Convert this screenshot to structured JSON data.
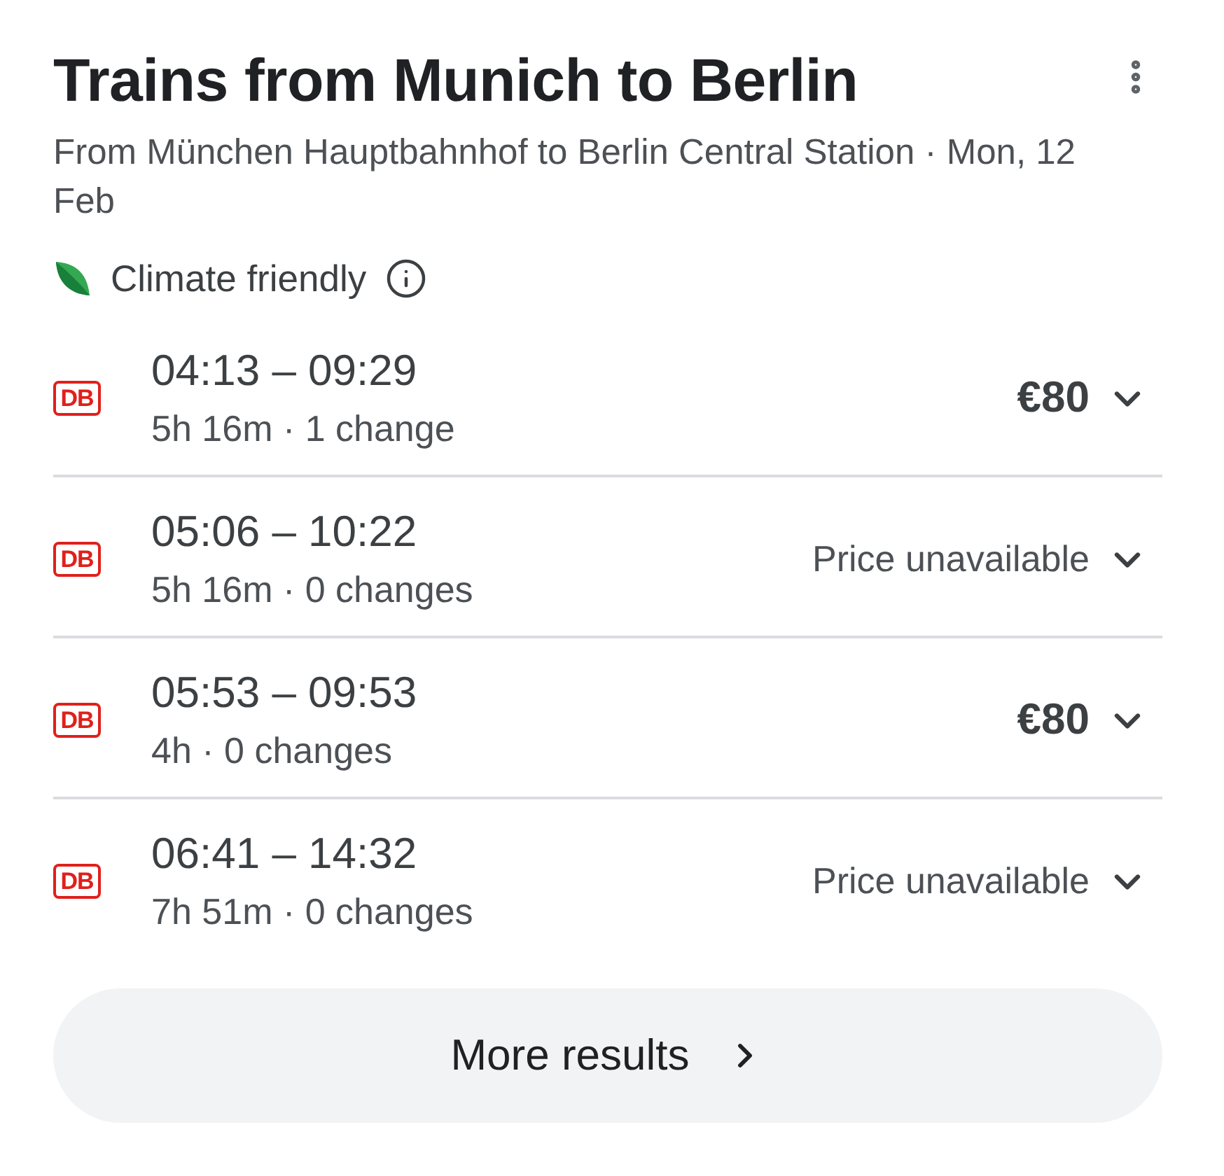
{
  "header": {
    "title": "Trains from Munich to Berlin",
    "subtitle": "From München Hauptbahnhof to Berlin Central Station · Mon, 12 Feb"
  },
  "badge": {
    "label": "Climate friendly"
  },
  "trips": [
    {
      "operator": "DB",
      "times": "04:13 – 09:29",
      "details": "5h 16m · 1 change",
      "kind": "fare",
      "price": "€80"
    },
    {
      "operator": "DB",
      "times": "05:06 – 10:22",
      "details": "5h 16m · 0 changes",
      "kind": "note",
      "price": "Price unavailable"
    },
    {
      "operator": "DB",
      "times": "05:53 – 09:53",
      "details": "4h · 0 changes",
      "kind": "fare",
      "price": "€80"
    },
    {
      "operator": "DB",
      "times": "06:41 – 14:32",
      "details": "7h 51m · 0 changes",
      "kind": "note",
      "price": "Price unavailable"
    }
  ],
  "more_button": {
    "label": "More results"
  }
}
